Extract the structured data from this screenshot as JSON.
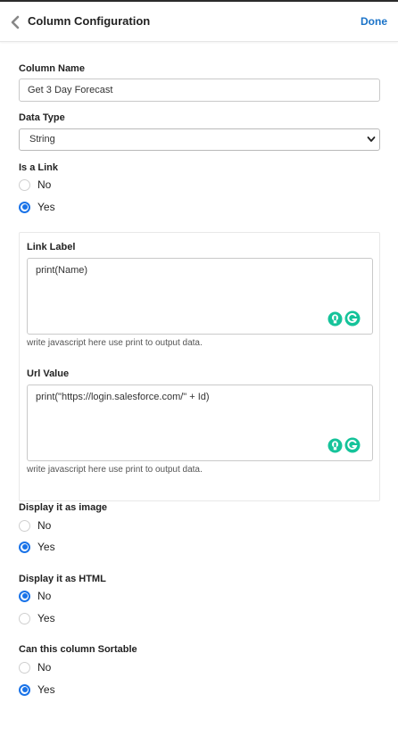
{
  "header": {
    "title": "Column Configuration",
    "done_label": "Done"
  },
  "column_name": {
    "label": "Column Name",
    "value": "Get 3 Day Forecast"
  },
  "data_type": {
    "label": "Data Type",
    "selected": "String"
  },
  "is_link": {
    "label": "Is a Link",
    "options": [
      "No",
      "Yes"
    ],
    "selected": "Yes"
  },
  "link_label": {
    "label": "Link Label",
    "value": "print(Name)",
    "helper": "write javascript here use print to output data."
  },
  "url_value": {
    "label": "Url Value",
    "value": "print(\"https://login.salesforce.com/\" + Id)",
    "helper": "write javascript here use print to output data."
  },
  "display_image": {
    "label": "Display it as image",
    "options": [
      "No",
      "Yes"
    ],
    "selected": "Yes"
  },
  "display_html": {
    "label": "Display it as HTML",
    "options": [
      "No",
      "Yes"
    ],
    "selected": "No"
  },
  "sortable": {
    "label": "Can this column Sortable",
    "options": [
      "No",
      "Yes"
    ],
    "selected": "Yes"
  },
  "colors": {
    "accent": "#1a73e8",
    "done": "#1a73c8",
    "grammarly": "#15c39a"
  }
}
